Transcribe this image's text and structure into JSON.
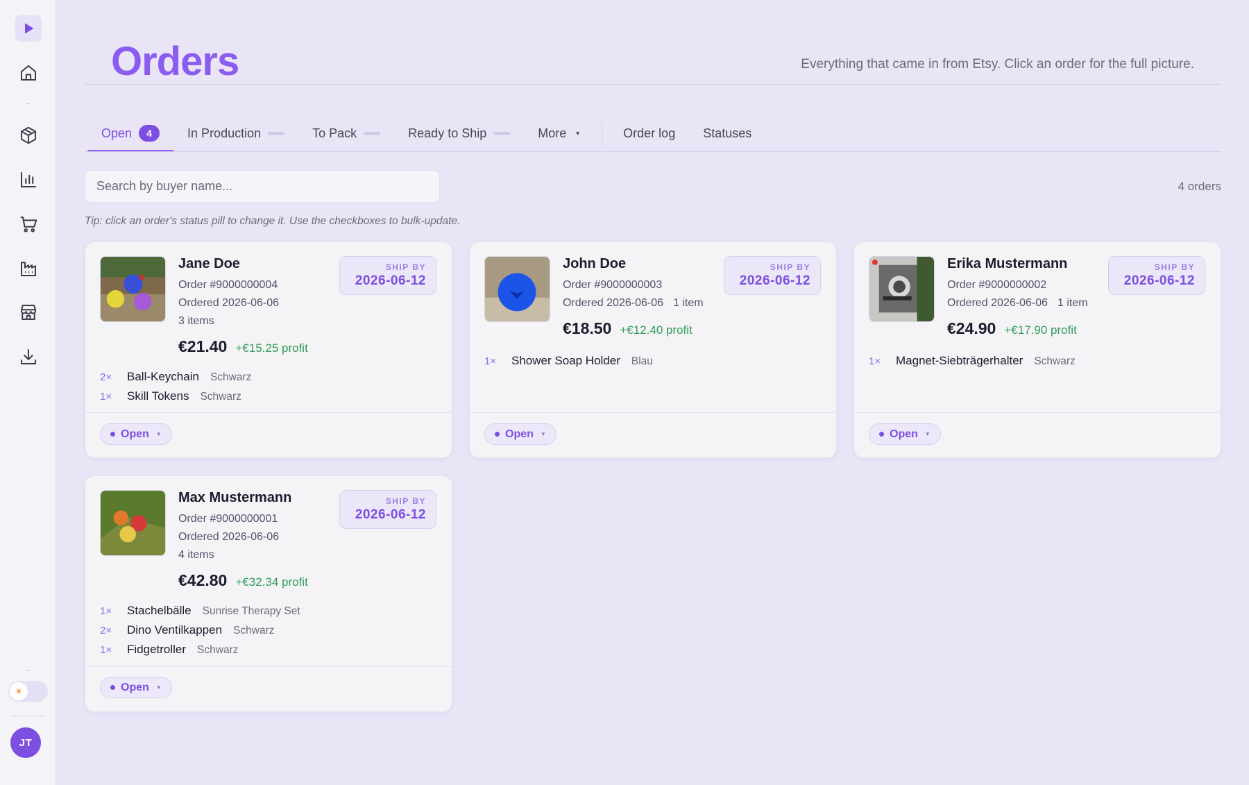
{
  "sidebar": {
    "avatar_initials": "JT",
    "icons": [
      "play-icon",
      "home-icon",
      "package-icon",
      "bar-chart-icon",
      "cart-icon",
      "factory-icon",
      "store-icon",
      "download-icon"
    ]
  },
  "header": {
    "title": "Orders",
    "subtitle": "Everything that came in from Etsy. Click an order for the full picture."
  },
  "tabs": [
    {
      "label": "Open",
      "badge": "4"
    },
    {
      "label": "In Production"
    },
    {
      "label": "To Pack"
    },
    {
      "label": "Ready to Ship"
    },
    {
      "label": "More"
    },
    {
      "label": "Order log"
    },
    {
      "label": "Statuses"
    }
  ],
  "search": {
    "placeholder": "Search by buyer name..."
  },
  "order_count": "4 orders",
  "tip": "Tip: click an order's status pill to change it. Use the checkboxes to bulk-update.",
  "ship_by_label": "SHIP BY",
  "orders": [
    {
      "buyer": "Jane Doe",
      "order_no": "Order #9000000004",
      "ordered": "Ordered 2026-06-06",
      "item_count": "3 items",
      "price": "€21.40",
      "profit": "+€15.25 profit",
      "ship_by": "2026-06-12",
      "status": "Open",
      "items": [
        {
          "qty": "2×",
          "name": "Ball-Keychain",
          "variant": "Schwarz"
        },
        {
          "qty": "1×",
          "name": "Skill Tokens",
          "variant": "Schwarz"
        }
      ]
    },
    {
      "buyer": "John Doe",
      "order_no": "Order #9000000003",
      "ordered": "Ordered 2026-06-06",
      "item_count": "1 item",
      "price": "€18.50",
      "profit": "+€12.40 profit",
      "ship_by": "2026-06-12",
      "status": "Open",
      "items": [
        {
          "qty": "1×",
          "name": "Shower Soap Holder",
          "variant": "Blau"
        }
      ]
    },
    {
      "buyer": "Erika Mustermann",
      "order_no": "Order #9000000002",
      "ordered": "Ordered 2026-06-06",
      "item_count": "1 item",
      "price": "€24.90",
      "profit": "+€17.90 profit",
      "ship_by": "2026-06-12",
      "status": "Open",
      "items": [
        {
          "qty": "1×",
          "name": "Magnet-Siebträgerhalter",
          "variant": "Schwarz"
        }
      ]
    },
    {
      "buyer": "Max Mustermann",
      "order_no": "Order #9000000001",
      "ordered": "Ordered 2026-06-06",
      "item_count": "4 items",
      "price": "€42.80",
      "profit": "+€32.34 profit",
      "ship_by": "2026-06-12",
      "status": "Open",
      "items": [
        {
          "qty": "1×",
          "name": "Stachelbälle",
          "variant": "Sunrise Therapy Set"
        },
        {
          "qty": "2×",
          "name": "Dino Ventilkappen",
          "variant": "Schwarz"
        },
        {
          "qty": "1×",
          "name": "Fidgetroller",
          "variant": "Schwarz"
        }
      ]
    }
  ]
}
